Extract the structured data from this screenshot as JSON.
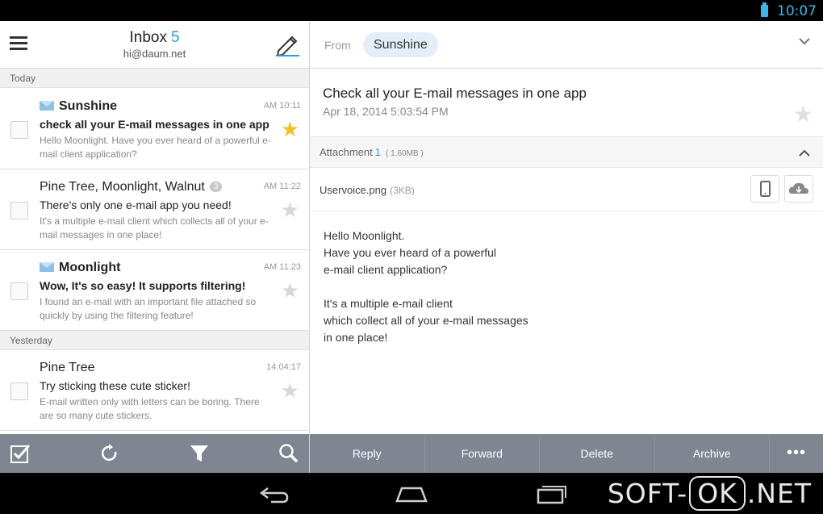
{
  "status_bar": {
    "time": "10:07",
    "battery_icon": "battery-icon"
  },
  "inbox": {
    "title": "Inbox",
    "unread_count": "5",
    "account": "hi@daum.net",
    "menu_icon": "menu-icon",
    "compose_icon": "compose-pencil-icon"
  },
  "sections": {
    "today": "Today",
    "yesterday": "Yesterday"
  },
  "mails": [
    {
      "sender": "Sunshine",
      "time": "AM 10:11",
      "subject": "check all your E-mail messages in one app",
      "preview": "Hello Moonlight. Have you ever heard of a powerful e-mail client application?",
      "unread": true,
      "starred": true
    },
    {
      "sender": "Pine Tree, Moonlight, Walnut",
      "badge": "3",
      "time": "AM 11:22",
      "subject": "There's only one e-mail app you need!",
      "preview": "It's a multiple e-mail client which collects all of your e-mail messages in one place!",
      "unread": false,
      "starred": false
    },
    {
      "sender": "Moonlight",
      "time": "AM 11:23",
      "subject": "Wow, It's so easy! It supports filtering!",
      "preview": "I found an e-mail with an important file attached so quickly by using the filtering feature!",
      "unread": true,
      "starred": false
    },
    {
      "sender": "Pine Tree",
      "time": "14:04:17",
      "subject": "Try sticking these cute sticker!",
      "preview": "E-mail written only with letters can be boring. There are so many cute stickers.",
      "unread": false,
      "starred": false
    }
  ],
  "message": {
    "from_label": "From",
    "from_name": "Sunshine",
    "subject": "Check all your E-mail messages in one app",
    "date": "Apr 18, 2014 5:03:54 PM",
    "attachment_label": "Attachment",
    "attachment_count": "1",
    "attachment_total_size": "( 1.60MB )",
    "attachment_filename": "Uservoice.png",
    "attachment_filesize": "(3KB)",
    "body_paragraphs": [
      "Hello Moonlight.\nHave you ever heard of a powerful\ne-mail client application?",
      "It's a multiple e-mail client\nwhich collect all of your e-mail messages\nin one place!"
    ]
  },
  "toolbar": {
    "left_icons": [
      "select-all-check-icon",
      "refresh-icon",
      "filter-icon",
      "search-icon"
    ],
    "reply": "Reply",
    "forward": "Forward",
    "delete": "Delete",
    "archive": "Archive",
    "more": "•••"
  },
  "nav_bar": {
    "icons": [
      "back-icon",
      "home-icon",
      "recent-apps-icon"
    ]
  },
  "watermark": {
    "prefix": "SOFT-",
    "boxed": "OK",
    "suffix": ".NET"
  },
  "colors": {
    "accent": "#2f9ad8",
    "toolbar": "#7f8591",
    "star_on": "#f3c22a",
    "status_blue": "#3fb4e6"
  }
}
